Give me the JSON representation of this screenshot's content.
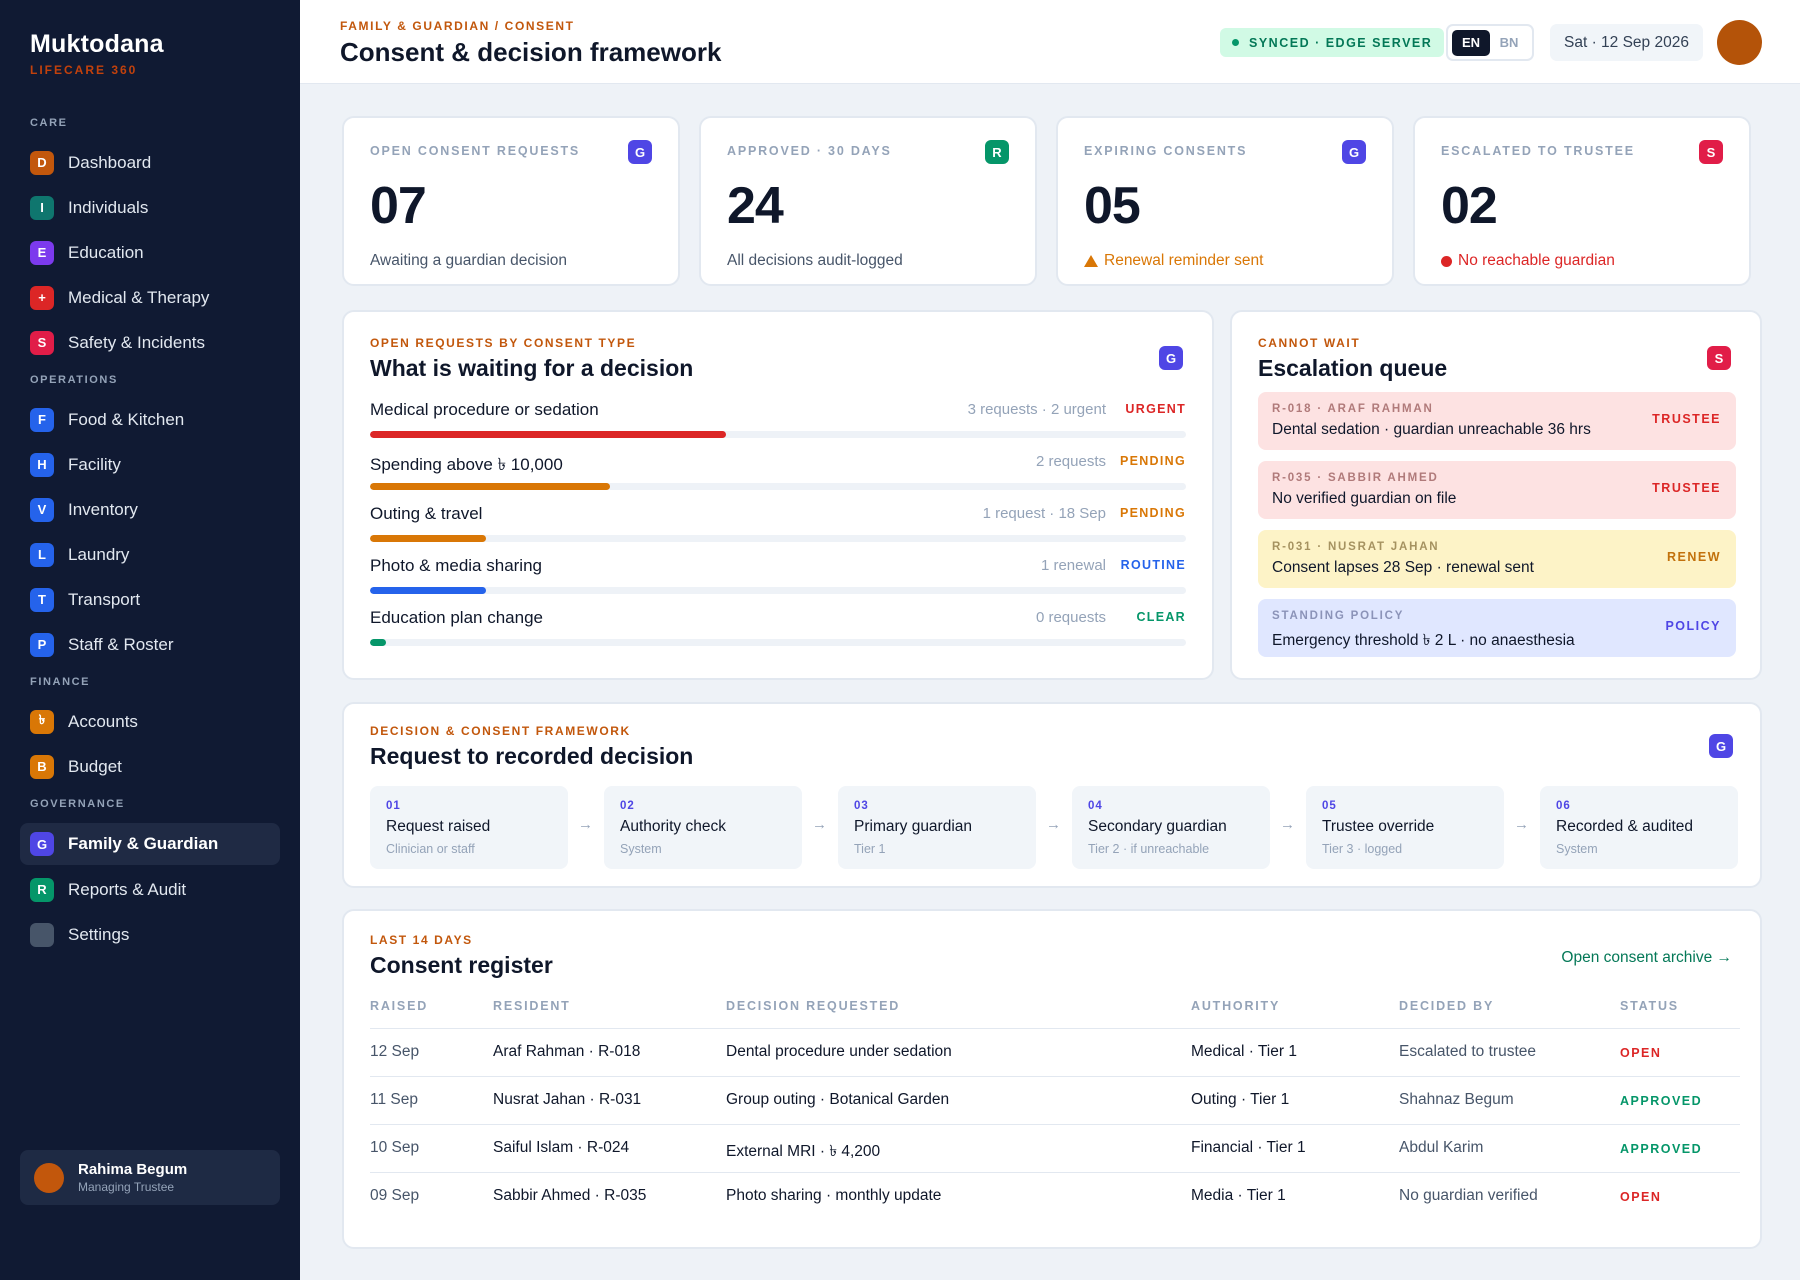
{
  "sidebar": {
    "brand": "Muktodana",
    "brand_sub": "LIFECARE 360",
    "sections": [
      {
        "title": "CARE",
        "items": [
          {
            "badge": "D",
            "label": "Dashboard",
            "color": "#c2570c"
          },
          {
            "badge": "I",
            "label": "Individuals",
            "color": "#0f766e"
          },
          {
            "badge": "E",
            "label": "Education",
            "color": "#7c3aed"
          },
          {
            "badge": "+",
            "label": "Medical & Therapy",
            "color": "#dc2626"
          },
          {
            "badge": "S",
            "label": "Safety & Incidents",
            "color": "#e11d48"
          }
        ]
      },
      {
        "title": "OPERATIONS",
        "items": [
          {
            "badge": "F",
            "label": "Food & Kitchen",
            "color": "#2563eb"
          },
          {
            "badge": "H",
            "label": "Facility",
            "color": "#2563eb"
          },
          {
            "badge": "V",
            "label": "Inventory",
            "color": "#2563eb"
          },
          {
            "badge": "L",
            "label": "Laundry",
            "color": "#2563eb"
          },
          {
            "badge": "T",
            "label": "Transport",
            "color": "#2563eb"
          },
          {
            "badge": "P",
            "label": "Staff & Roster",
            "color": "#2563eb"
          }
        ]
      },
      {
        "title": "FINANCE",
        "items": [
          {
            "badge": "৳",
            "label": "Accounts",
            "color": "#d97706"
          },
          {
            "badge": "B",
            "label": "Budget",
            "color": "#d97706"
          }
        ]
      },
      {
        "title": "GOVERNANCE",
        "items": [
          {
            "badge": "G",
            "label": "Family & Guardian",
            "color": "#4f46e5",
            "active": true
          },
          {
            "badge": "R",
            "label": "Reports & Audit",
            "color": "#059669"
          },
          {
            "badge": "",
            "label": "Settings",
            "color": "#475569"
          }
        ]
      }
    ],
    "user": {
      "name": "Rahima Begum",
      "role": "Managing Trustee"
    }
  },
  "header": {
    "breadcrumb": "FAMILY & GUARDIAN / CONSENT",
    "title": "Consent & decision framework",
    "sync_status": "SYNCED · EDGE SERVER",
    "lang_en": "EN",
    "lang_bn": "BN",
    "date": "Sat · 12 Sep 2026"
  },
  "stats": [
    {
      "label": "OPEN CONSENT REQUESTS",
      "tag": "G",
      "tag_color": "#4f46e5",
      "value": "07",
      "note": "Awaiting a guardian decision",
      "note_color": "#475569",
      "note_icon": ""
    },
    {
      "label": "APPROVED · 30 DAYS",
      "tag": "R",
      "tag_color": "#059669",
      "value": "24",
      "note": "All decisions audit-logged",
      "note_color": "#475569",
      "note_icon": ""
    },
    {
      "label": "EXPIRING CONSENTS",
      "tag": "G",
      "tag_color": "#4f46e5",
      "value": "05",
      "note": "Renewal reminder sent",
      "note_color": "#d97706",
      "note_icon": "warning"
    },
    {
      "label": "ESCALATED TO TRUSTEE",
      "tag": "S",
      "tag_color": "#e11d48",
      "value": "02",
      "note": "No reachable guardian",
      "note_color": "#dc2626",
      "note_icon": "alert-dot"
    }
  ],
  "requests": {
    "kicker": "OPEN REQUESTS BY CONSENT TYPE",
    "title": "What is waiting for a decision",
    "tag": "G",
    "rows": [
      {
        "label": "Medical procedure or sedation",
        "meta": "3 requests · 2 urgent",
        "status": "URGENT",
        "status_color": "#dc2626",
        "bar_color": "#dc2626",
        "fill": 0.436
      },
      {
        "label": "Spending above ৳ 10,000",
        "meta": "2 requests",
        "status": "PENDING",
        "status_color": "#d97706",
        "bar_color": "#d97706",
        "fill": 0.294
      },
      {
        "label": "Outing & travel",
        "meta": "1 request · 18 Sep",
        "status": "PENDING",
        "status_color": "#d97706",
        "bar_color": "#d97706",
        "fill": 0.142
      },
      {
        "label": "Photo & media sharing",
        "meta": "1 renewal",
        "status": "ROUTINE",
        "status_color": "#2563eb",
        "bar_color": "#2563eb",
        "fill": 0.142
      },
      {
        "label": "Education plan change",
        "meta": "0 requests",
        "status": "CLEAR",
        "status_color": "#059669",
        "bar_color": "#059669",
        "fill": 0.02
      }
    ]
  },
  "escalation": {
    "kicker": "CANNOT WAIT",
    "title": "Escalation queue",
    "tag": "S",
    "items": [
      {
        "ref": "R-018 · ARAF RAHMAN",
        "text": "Dental sedation · guardian unreachable 36 hrs",
        "tag": "TRUSTEE",
        "bg": "#fde2e2",
        "ref_color": "#b07a7a",
        "tag_color": "#dc2626"
      },
      {
        "ref": "R-035 · SABBIR AHMED",
        "text": "No verified guardian on file",
        "tag": "TRUSTEE",
        "bg": "#fde2e2",
        "ref_color": "#b07a7a",
        "tag_color": "#dc2626"
      },
      {
        "ref": "R-031 · NUSRAT JAHAN",
        "text": "Consent lapses 28 Sep · renewal sent",
        "tag": "RENEW",
        "bg": "#fdf3c7",
        "ref_color": "#a59260",
        "tag_color": "#c2710c"
      },
      {
        "ref": "STANDING POLICY",
        "text": "Emergency threshold ৳ 2 L · no anaesthesia",
        "tag": "POLICY",
        "bg": "#e0e7ff",
        "ref_color": "#8b93b8",
        "tag_color": "#4f46e5"
      }
    ]
  },
  "framework": {
    "kicker": "DECISION & CONSENT FRAMEWORK",
    "title": "Request to recorded decision",
    "tag": "G",
    "steps": [
      {
        "num": "01",
        "name": "Request raised",
        "sub": "Clinician or staff"
      },
      {
        "num": "02",
        "name": "Authority check",
        "sub": "System"
      },
      {
        "num": "03",
        "name": "Primary guardian",
        "sub": "Tier 1"
      },
      {
        "num": "04",
        "name": "Secondary guardian",
        "sub": "Tier 2 · if unreachable"
      },
      {
        "num": "05",
        "name": "Trustee override",
        "sub": "Tier 3 · logged"
      },
      {
        "num": "06",
        "name": "Recorded & audited",
        "sub": "System"
      }
    ]
  },
  "register": {
    "kicker": "LAST 14 DAYS",
    "title": "Consent register",
    "link": "Open consent archive →",
    "columns": [
      "RAISED",
      "RESIDENT",
      "DECISION REQUESTED",
      "AUTHORITY",
      "DECIDED BY",
      "STATUS"
    ],
    "rows": [
      {
        "raised": "12 Sep",
        "resident": "Araf Rahman · R-018",
        "decision": "Dental procedure under sedation",
        "authority": "Medical · Tier 1",
        "decided_by": "Escalated to trustee",
        "status": "OPEN",
        "status_color": "#dc2626"
      },
      {
        "raised": "11 Sep",
        "resident": "Nusrat Jahan · R-031",
        "decision": "Group outing · Botanical Garden",
        "authority": "Outing · Tier 1",
        "decided_by": "Shahnaz Begum",
        "status": "APPROVED",
        "status_color": "#059669"
      },
      {
        "raised": "10 Sep",
        "resident": "Saiful Islam · R-024",
        "decision": "External MRI · ৳ 4,200",
        "authority": "Financial · Tier 1",
        "decided_by": "Abdul Karim",
        "status": "APPROVED",
        "status_color": "#059669"
      },
      {
        "raised": "09 Sep",
        "resident": "Sabbir Ahmed · R-035",
        "decision": "Photo sharing · monthly update",
        "authority": "Media · Tier 1",
        "decided_by": "No guardian verified",
        "status": "OPEN",
        "status_color": "#dc2626"
      }
    ]
  }
}
